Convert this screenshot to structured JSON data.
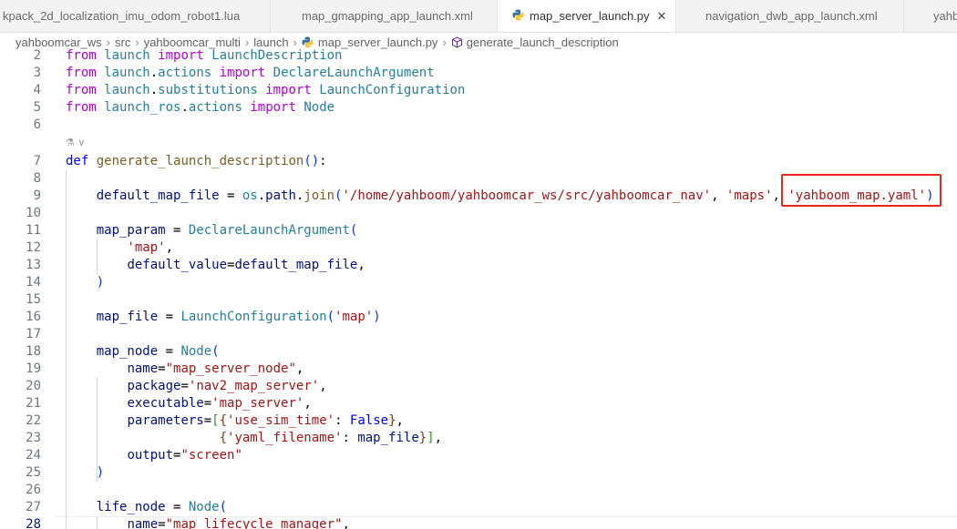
{
  "tabs": [
    {
      "label": "kpack_2d_localization_imu_odom_robot1.lua",
      "icon": "none",
      "active": false
    },
    {
      "label": "map_gmapping_app_launch.xml",
      "icon": "rss-icon",
      "active": false
    },
    {
      "label": "map_server_launch.py",
      "icon": "python-icon",
      "active": true,
      "close": "✕"
    },
    {
      "label": "navigation_dwb_app_launch.xml",
      "icon": "rss-icon",
      "active": false
    },
    {
      "label": "yahb",
      "icon": "rss-icon",
      "active": false
    }
  ],
  "breadcrumb": {
    "items": [
      "yahboomcar_ws",
      "src",
      "yahboomcar_multi",
      "launch",
      "map_server_launch.py",
      "generate_launch_description"
    ],
    "separator": "›"
  },
  "editor": {
    "current_line": "28",
    "codelens": "⚗ ∨",
    "lines": [
      {
        "n": "2",
        "tokens": [
          [
            "kw",
            "from"
          ],
          [
            "pun",
            " "
          ],
          [
            "mod",
            "launch"
          ],
          [
            "pun",
            " "
          ],
          [
            "kw",
            "import"
          ],
          [
            "pun",
            " "
          ],
          [
            "cls",
            "LaunchDescription"
          ]
        ]
      },
      {
        "n": "3",
        "tokens": [
          [
            "kw",
            "from"
          ],
          [
            "pun",
            " "
          ],
          [
            "mod",
            "launch"
          ],
          [
            "pun",
            "."
          ],
          [
            "mod",
            "actions"
          ],
          [
            "pun",
            " "
          ],
          [
            "kw",
            "import"
          ],
          [
            "pun",
            " "
          ],
          [
            "cls",
            "DeclareLaunchArgument"
          ]
        ]
      },
      {
        "n": "4",
        "tokens": [
          [
            "kw",
            "from"
          ],
          [
            "pun",
            " "
          ],
          [
            "mod",
            "launch"
          ],
          [
            "pun",
            "."
          ],
          [
            "mod",
            "substitutions"
          ],
          [
            "pun",
            " "
          ],
          [
            "kw",
            "import"
          ],
          [
            "pun",
            " "
          ],
          [
            "cls",
            "LaunchConfiguration"
          ]
        ]
      },
      {
        "n": "5",
        "tokens": [
          [
            "kw",
            "from"
          ],
          [
            "pun",
            " "
          ],
          [
            "mod",
            "launch_ros"
          ],
          [
            "pun",
            "."
          ],
          [
            "mod",
            "actions"
          ],
          [
            "pun",
            " "
          ],
          [
            "kw",
            "import"
          ],
          [
            "pun",
            " "
          ],
          [
            "cls",
            "Node"
          ]
        ]
      },
      {
        "n": "6",
        "tokens": []
      },
      {
        "n": "7",
        "tokens": [
          [
            "kw2",
            "def"
          ],
          [
            "pun",
            " "
          ],
          [
            "fn",
            "generate_launch_description"
          ],
          [
            "br1",
            "()"
          ],
          [
            "pun",
            ":"
          ]
        ]
      },
      {
        "n": "8",
        "tokens": []
      },
      {
        "n": "9",
        "tokens": [
          [
            "pun",
            "    "
          ],
          [
            "var",
            "default_map_file"
          ],
          [
            "pun",
            " = "
          ],
          [
            "mod",
            "os"
          ],
          [
            "pun",
            "."
          ],
          [
            "var",
            "path"
          ],
          [
            "pun",
            "."
          ],
          [
            "fn",
            "join"
          ],
          [
            "br1",
            "("
          ],
          [
            "str",
            "'/home/yahboom/yahboomcar_ws/src/yahboomcar_nav'"
          ],
          [
            "pun",
            ", "
          ],
          [
            "str",
            "'maps'"
          ],
          [
            "pun",
            ", "
          ],
          [
            "str",
            "'yahboom_map.yaml'"
          ],
          [
            "br1",
            ")"
          ]
        ]
      },
      {
        "n": "10",
        "tokens": []
      },
      {
        "n": "11",
        "tokens": [
          [
            "pun",
            "    "
          ],
          [
            "var",
            "map_param"
          ],
          [
            "pun",
            " = "
          ],
          [
            "cls",
            "DeclareLaunchArgument"
          ],
          [
            "br1",
            "("
          ]
        ]
      },
      {
        "n": "12",
        "tokens": [
          [
            "pun",
            "        "
          ],
          [
            "str",
            "'map'"
          ],
          [
            "pun",
            ","
          ]
        ]
      },
      {
        "n": "13",
        "tokens": [
          [
            "pun",
            "        "
          ],
          [
            "var",
            "default_value"
          ],
          [
            "pun",
            "="
          ],
          [
            "var",
            "default_map_file"
          ],
          [
            "pun",
            ","
          ]
        ]
      },
      {
        "n": "14",
        "tokens": [
          [
            "pun",
            "    "
          ],
          [
            "br1",
            ")"
          ]
        ]
      },
      {
        "n": "15",
        "tokens": []
      },
      {
        "n": "16",
        "tokens": [
          [
            "pun",
            "    "
          ],
          [
            "var",
            "map_file"
          ],
          [
            "pun",
            " = "
          ],
          [
            "cls",
            "LaunchConfiguration"
          ],
          [
            "br1",
            "("
          ],
          [
            "str",
            "'map'"
          ],
          [
            "br1",
            ")"
          ]
        ]
      },
      {
        "n": "17",
        "tokens": []
      },
      {
        "n": "18",
        "tokens": [
          [
            "pun",
            "    "
          ],
          [
            "var",
            "map_node"
          ],
          [
            "pun",
            " = "
          ],
          [
            "cls",
            "Node"
          ],
          [
            "br1",
            "("
          ]
        ]
      },
      {
        "n": "19",
        "tokens": [
          [
            "pun",
            "        "
          ],
          [
            "var",
            "name"
          ],
          [
            "pun",
            "="
          ],
          [
            "str",
            "\"map_server_node\""
          ],
          [
            "pun",
            ","
          ]
        ]
      },
      {
        "n": "20",
        "tokens": [
          [
            "pun",
            "        "
          ],
          [
            "var",
            "package"
          ],
          [
            "pun",
            "="
          ],
          [
            "str",
            "'nav2_map_server'"
          ],
          [
            "pun",
            ","
          ]
        ]
      },
      {
        "n": "21",
        "tokens": [
          [
            "pun",
            "        "
          ],
          [
            "var",
            "executable"
          ],
          [
            "pun",
            "="
          ],
          [
            "str",
            "'map_server'"
          ],
          [
            "pun",
            ","
          ]
        ]
      },
      {
        "n": "22",
        "tokens": [
          [
            "pun",
            "        "
          ],
          [
            "var",
            "parameters"
          ],
          [
            "pun",
            "="
          ],
          [
            "br2",
            "["
          ],
          [
            "br3",
            "{"
          ],
          [
            "str",
            "'use_sim_time'"
          ],
          [
            "pun",
            ": "
          ],
          [
            "kw2",
            "False"
          ],
          [
            "br3",
            "}"
          ],
          [
            "pun",
            ","
          ]
        ]
      },
      {
        "n": "23",
        "tokens": [
          [
            "pun",
            "                    "
          ],
          [
            "br3",
            "{"
          ],
          [
            "str",
            "'yaml_filename'"
          ],
          [
            "pun",
            ": "
          ],
          [
            "var",
            "map_file"
          ],
          [
            "br3",
            "}"
          ],
          [
            "br2",
            "]"
          ],
          [
            "pun",
            ","
          ]
        ]
      },
      {
        "n": "24",
        "tokens": [
          [
            "pun",
            "        "
          ],
          [
            "var",
            "output"
          ],
          [
            "pun",
            "="
          ],
          [
            "str",
            "\"screen\""
          ]
        ]
      },
      {
        "n": "25",
        "tokens": [
          [
            "pun",
            "    "
          ],
          [
            "br1",
            ")"
          ]
        ]
      },
      {
        "n": "26",
        "tokens": []
      },
      {
        "n": "27",
        "tokens": [
          [
            "pun",
            "    "
          ],
          [
            "var",
            "life_node"
          ],
          [
            "pun",
            " = "
          ],
          [
            "cls",
            "Node"
          ],
          [
            "br1",
            "("
          ]
        ]
      },
      {
        "n": "28",
        "tokens": [
          [
            "pun",
            "        "
          ],
          [
            "var",
            "name"
          ],
          [
            "pun",
            "="
          ],
          [
            "str",
            "\"map_lifecycle_manager\""
          ],
          [
            "pun",
            ","
          ]
        ]
      }
    ]
  },
  "colors": {
    "highlight_box": "#e8271b",
    "keyword": "#af00db",
    "type": "#267f99",
    "string": "#a31515"
  }
}
